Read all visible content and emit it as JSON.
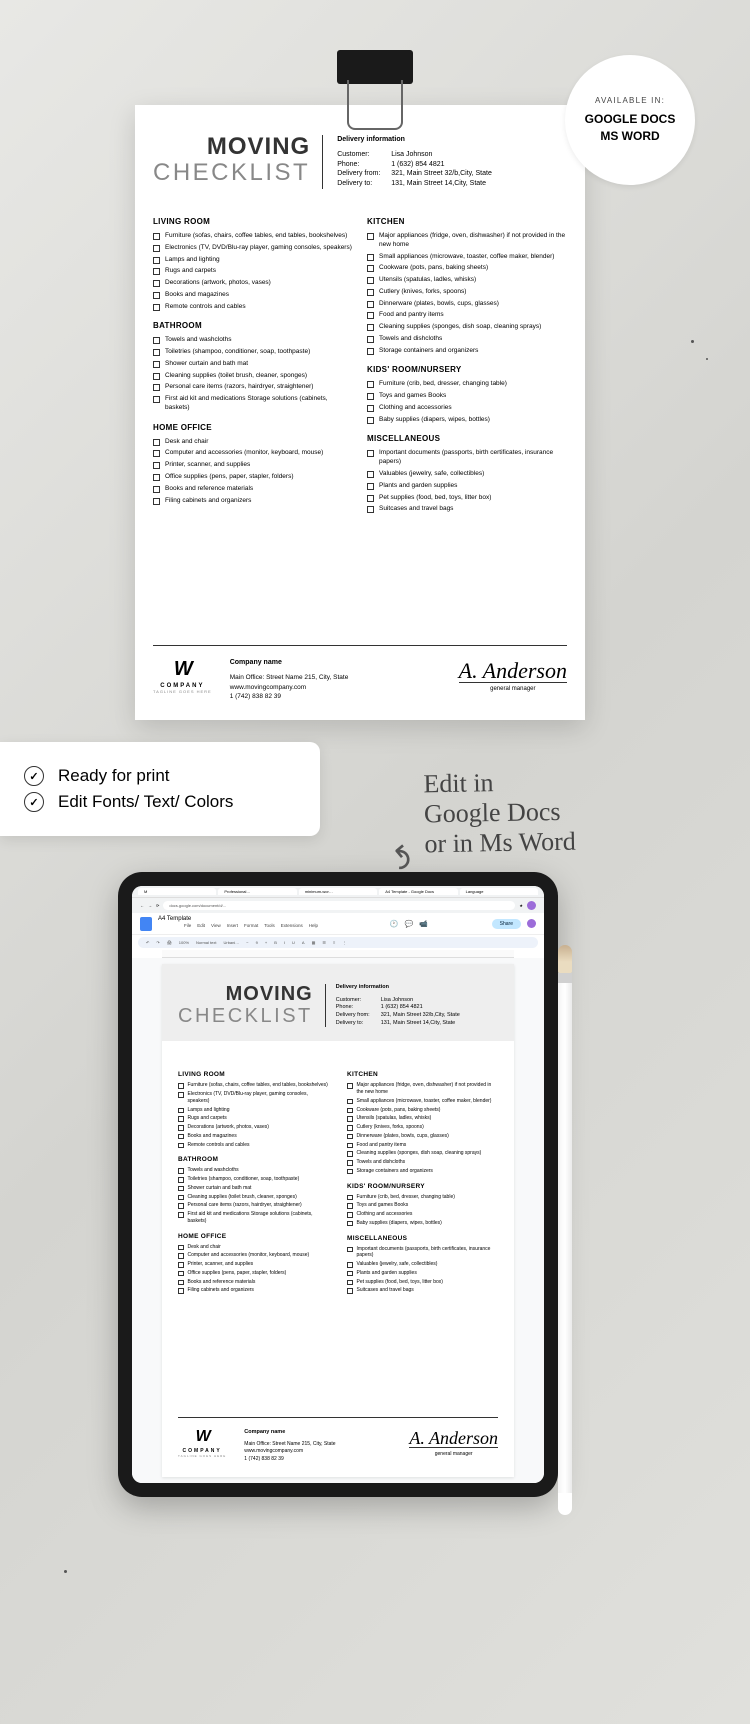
{
  "badge": {
    "available": "AVAILABLE IN:",
    "apps": "GOOGLE DOCS\nMS WORD"
  },
  "title": {
    "line1": "MOVING",
    "line2": "CHECKLIST"
  },
  "delivery": {
    "heading": "Delivery information",
    "rows": [
      {
        "label": "Customer:",
        "value": "Lisa Johnson"
      },
      {
        "label": "Phone:",
        "value": "1 (632) 854 4821"
      },
      {
        "label": "Delivery from:",
        "value": "321, Main Street 32/b,City, State"
      },
      {
        "label": "Delivery to:",
        "value": "131, Main Street 14,City, State"
      }
    ]
  },
  "left_sections": [
    {
      "title": "LIVING ROOM",
      "items": [
        "Furniture (sofas, chairs, coffee tables, end tables, bookshelves)",
        "Electronics (TV, DVD/Blu-ray player, gaming consoles, speakers)",
        "Lamps and lighting",
        "Rugs and carpets",
        "Decorations (artwork, photos, vases)",
        "Books and magazines",
        "Remote controls and cables"
      ]
    },
    {
      "title": "BATHROOM",
      "items": [
        "Towels and washcloths",
        "Toiletries (shampoo, conditioner, soap, toothpaste)",
        "Shower curtain and bath mat",
        "Cleaning supplies (toilet brush, cleaner, sponges)",
        "Personal care items (razors, hairdryer, straightener)",
        "First aid kit and medications Storage solutions (cabinets, baskets)"
      ]
    },
    {
      "title": "HOME OFFICE",
      "items": [
        "Desk and chair",
        "Computer and accessories (monitor, keyboard, mouse)",
        "Printer, scanner, and supplies",
        "Office supplies (pens, paper, stapler, folders)",
        "Books and reference materials",
        "Filing cabinets and organizers"
      ]
    }
  ],
  "right_sections": [
    {
      "title": "KITCHEN",
      "items": [
        "Major appliances (fridge, oven, dishwasher) if not provided in the new home",
        "Small appliances (microwave, toaster, coffee maker, blender)",
        "Cookware (pots, pans, baking sheets)",
        "Utensils (spatulas, ladles, whisks)",
        "Cutlery (knives, forks, spoons)",
        "Dinnerware (plates, bowls, cups, glasses)",
        "Food and pantry items",
        "Cleaning supplies (sponges, dish soap, cleaning sprays)",
        "Towels and dishcloths",
        "Storage containers and organizers"
      ]
    },
    {
      "title": "KIDS' ROOM/NURSERY",
      "items": [
        "Furniture (crib, bed, dresser, changing table)",
        "Toys and games Books",
        "Clothing and accessories",
        "Baby supplies (diapers, wipes, bottles)"
      ]
    },
    {
      "title": "MISCELLANEOUS",
      "items": [
        "Important documents (passports, birth certificates, insurance papers)",
        "Valuables (jewelry, safe, collectibles)",
        "Plants and garden supplies",
        "Pet supplies (food, bed, toys, litter box)",
        "Suitcases and travel bags"
      ]
    }
  ],
  "company": {
    "logo_text": "COMPANY",
    "logo_sub": "TAGLINE GOES HERE",
    "name": "Company name",
    "address": "Main Office: Street Name 215, City, State",
    "web": "www.movingcompany.com",
    "phone": "1 (742) 838 82 39"
  },
  "signature": {
    "name": "A. Anderson",
    "role": "general manager"
  },
  "features": [
    "Ready for print",
    "Edit Fonts/ Text/ Colors"
  ],
  "handwriting": "Edit in\nGoogle Docs\nor in Ms Word",
  "gdocs": {
    "doc_title": "A4 Template",
    "url": "docs.google.com/document/d/...",
    "share": "Share",
    "menus": [
      "File",
      "Edit",
      "View",
      "Insert",
      "Format",
      "Tools",
      "Extensions",
      "Help"
    ],
    "toolbar": [
      "↶",
      "↷",
      "🖨",
      "100%",
      "Normal text",
      "Urbani…",
      "−",
      "9",
      "+",
      "B",
      "I",
      "U",
      "A",
      "▦",
      "☰",
      "≡",
      "⋮"
    ]
  }
}
